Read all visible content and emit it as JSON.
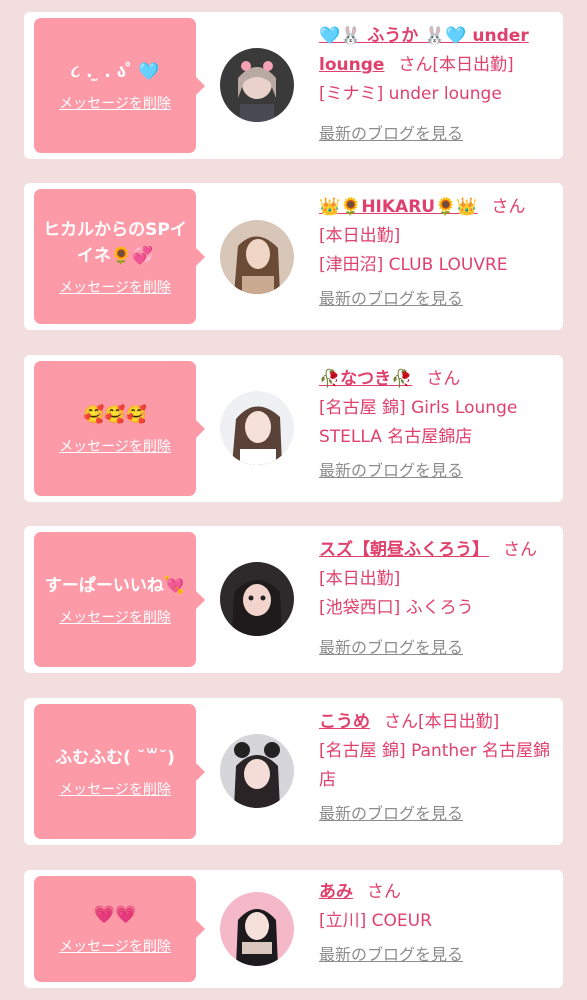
{
  "items": [
    {
      "message": "૮ .  ̫ . ა ̊ 🩵",
      "delete_label": "メッセージを削除",
      "name": "🩵🐰 ふうか 🐰🩵 under lounge",
      "honorific": "さん",
      "status": "[本日出勤]",
      "shop": "[ミナミ] under lounge",
      "blog_label": "最新のブログを見る"
    },
    {
      "message": "ヒカルからのSPイイネ🌻💞",
      "delete_label": "メッセージを削除",
      "name": "👑🌻HIKARU🌻👑",
      "honorific": "さん",
      "status": "[本日出勤]",
      "shop": "[津田沼] CLUB LOUVRE",
      "blog_label": "最新のブログを見る"
    },
    {
      "message": "🥰🥰🥰",
      "delete_label": "メッセージを削除",
      "name": "🥀なつき🥀",
      "honorific": "さん",
      "status": "",
      "shop": "[名古屋 錦] Girls Lounge STELLA 名古屋錦店",
      "blog_label": "最新のブログを見る"
    },
    {
      "message": "すーぱーいいね💘",
      "delete_label": "メッセージを削除",
      "name": "スズ【朝昼ふくろう】",
      "honorific": "さん",
      "status": "[本日出勤]",
      "shop": "[池袋西口] ふくろう",
      "blog_label": "最新のブログを見る"
    },
    {
      "message": "ふむふむ( ˘꒳˘)",
      "delete_label": "メッセージを削除",
      "name": "こうめ",
      "honorific": "さん",
      "status": "[本日出勤]",
      "shop": "[名古屋 錦] Panther 名古屋錦店",
      "blog_label": "最新のブログを見る"
    },
    {
      "message": "💗💗",
      "delete_label": "メッセージを削除",
      "name": "あみ",
      "honorific": "さん",
      "status": "",
      "shop": "[立川] COEUR",
      "blog_label": "最新のブログを見る"
    }
  ],
  "colors": {
    "background": "#f2dede",
    "bubble": "#fd9aa8",
    "accent": "#e0416c",
    "link_gray": "#8c8c8c"
  }
}
